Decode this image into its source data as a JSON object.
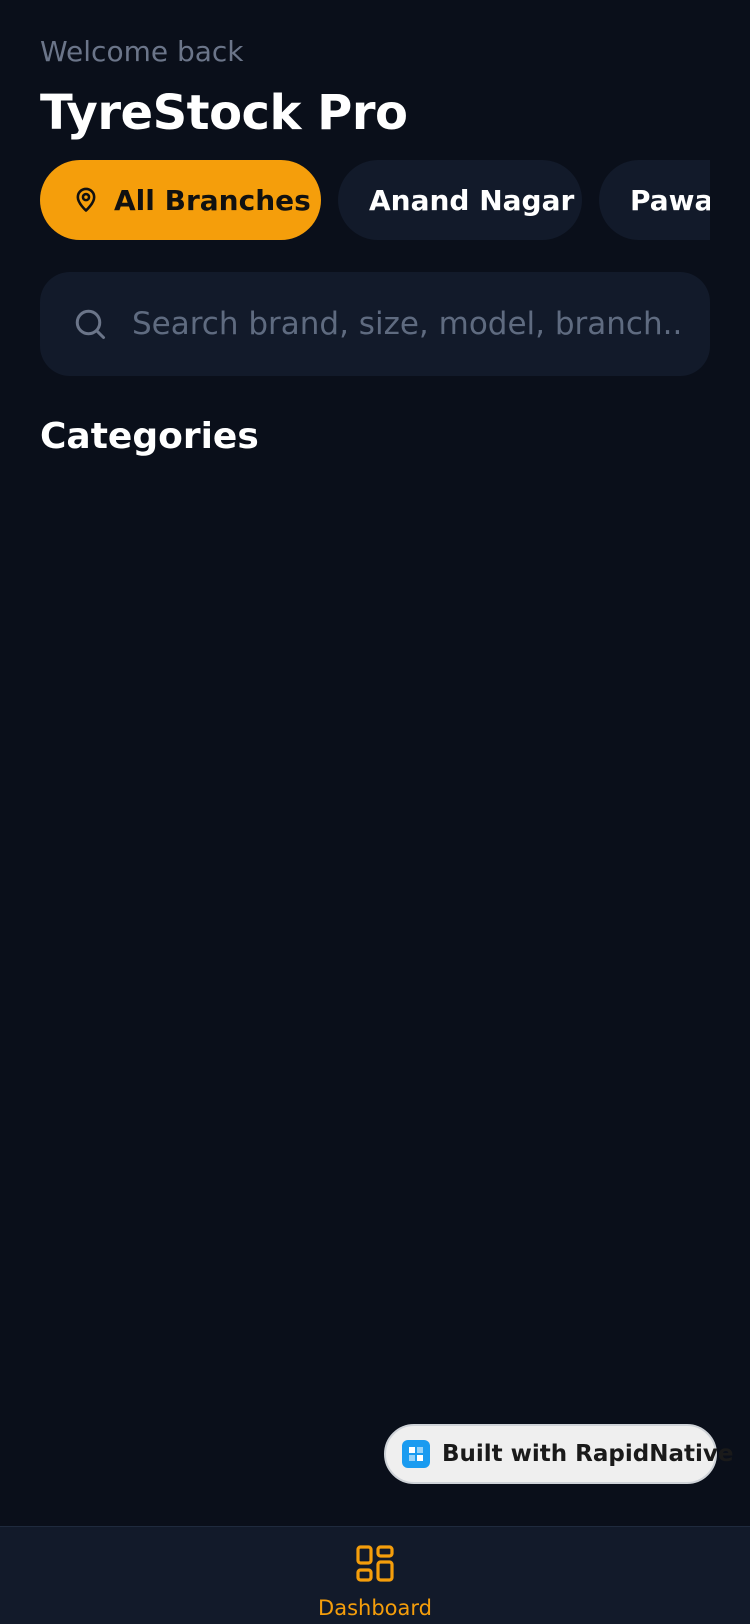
{
  "header": {
    "greeting": "Welcome back",
    "app_title": "TyreStock Pro"
  },
  "branches": [
    {
      "label": "All Branches",
      "active": true,
      "icon": "map-pin-icon"
    },
    {
      "label": "Anand Nagar",
      "active": false
    },
    {
      "label": "Pawa",
      "active": false
    }
  ],
  "search": {
    "placeholder": "Search brand, size, model, branch...",
    "value": ""
  },
  "categories": {
    "title": "Categories"
  },
  "badge": {
    "label": "Built with RapidNative",
    "icon": "rapidnative-logo-icon"
  },
  "tabbar": {
    "tabs": [
      {
        "label": "Dashboard",
        "icon": "dashboard-grid-icon",
        "active": true
      }
    ]
  },
  "colors": {
    "background": "#0a0f1a",
    "surface": "#121a2a",
    "accent": "#f59e0b",
    "muted_text": "#6b7589"
  }
}
